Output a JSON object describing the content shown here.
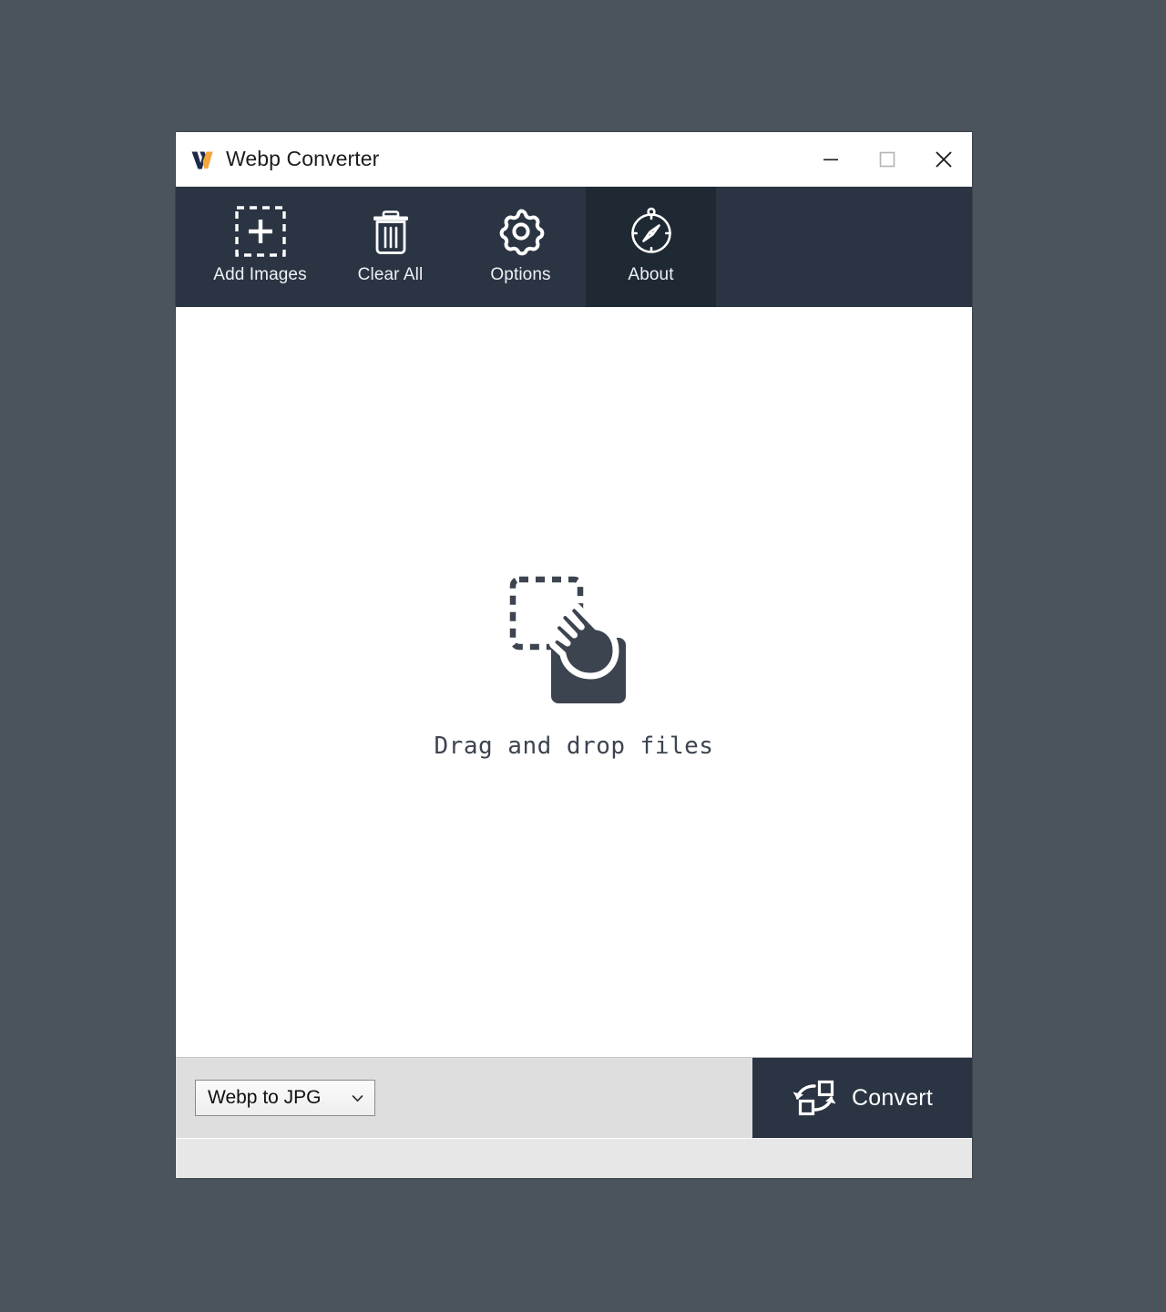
{
  "window": {
    "title": "Webp Converter",
    "logo_icon": "webp-w-logo",
    "logo_colors": {
      "dark": "#1f2a4a",
      "accent": "#f5a63b"
    },
    "controls": {
      "minimize": {
        "icon": "minimize-icon",
        "label": "Minimize"
      },
      "maximize": {
        "icon": "maximize-icon",
        "label": "Maximize"
      },
      "close": {
        "icon": "close-icon",
        "label": "Close"
      }
    }
  },
  "theme": {
    "desktop_background": "#4b545d",
    "toolbar_background": "#2a3442",
    "toolbar_active_background": "#1f2934",
    "accent": "#f5a63b",
    "content_background": "#ffffff",
    "action_bar_background": "#dedede",
    "status_bar_background": "#e7e7e7"
  },
  "toolbar": {
    "items": [
      {
        "label": "Add Images",
        "icon": "add-images-icon",
        "active": false
      },
      {
        "label": "Clear All",
        "icon": "trash-icon",
        "active": false
      },
      {
        "label": "Options",
        "icon": "gear-icon",
        "active": false
      },
      {
        "label": "About",
        "icon": "compass-icon",
        "active": true
      }
    ]
  },
  "drop_area": {
    "icon": "drag-and-drop-icon",
    "message": "Drag and drop files",
    "file_count": 0
  },
  "action_bar": {
    "format_select": {
      "selected": "Webp to JPG",
      "chevron_icon": "chevron-down-icon",
      "options": [
        "Webp to JPG"
      ]
    },
    "convert_button": {
      "label": "Convert",
      "icon": "convert-icon"
    }
  },
  "status_bar": {
    "text": ""
  }
}
